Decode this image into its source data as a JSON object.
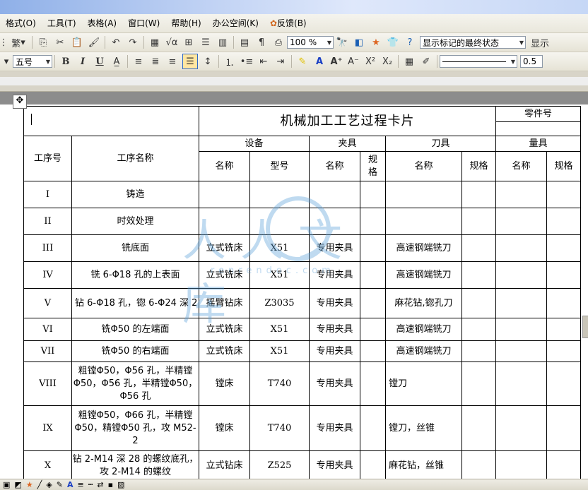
{
  "menubar": {
    "items": [
      "格式(O)",
      "工具(T)",
      "表格(A)",
      "窗口(W)",
      "帮助(H)",
      "办公空间(K)",
      "反馈(B)"
    ]
  },
  "toolbar1": {
    "traditional_label": "繁",
    "zoom_value": "100 %",
    "markup_display": "显示标记的最终状态",
    "show_label": "显示"
  },
  "toolbar2": {
    "font_size": "五号",
    "bold": "B",
    "italic": "I",
    "underline": "U",
    "line_width": "0.5"
  },
  "table": {
    "title": "机械加工工艺过程卡片",
    "part_no_label": "零件号",
    "col_step_no": "工序号",
    "col_step_name": "工序名称",
    "group_equipment": "设备",
    "group_fixture": "夹具",
    "group_tool": "刀具",
    "group_gauge": "量具",
    "sub_name": "名称",
    "sub_model": "型号",
    "sub_spec": "规格",
    "sub_spec_split": "规\n格",
    "rows": [
      {
        "no": "I",
        "name": "铸造",
        "eq_name": "",
        "eq_model": "",
        "fx_name": "",
        "tool_name": ""
      },
      {
        "no": "II",
        "name": "时效处理",
        "eq_name": "",
        "eq_model": "",
        "fx_name": "",
        "tool_name": ""
      },
      {
        "no": "III",
        "name": "铣底面",
        "eq_name": "立式铣床",
        "eq_model": "X51",
        "fx_name": "专用夹具",
        "tool_name": "高速钢端铣刀"
      },
      {
        "no": "IV",
        "name": "铣 6-Φ18 孔的上表面",
        "eq_name": "立式铣床",
        "eq_model": "X51",
        "fx_name": "专用夹具",
        "tool_name": "高速钢端铣刀"
      },
      {
        "no": "V",
        "name": "钻 6-Φ18 孔，锪 6-Φ24 深 2",
        "eq_name": "摇臂钻床",
        "eq_model": "Z3035",
        "fx_name": "专用夹具",
        "tool_name": "麻花钻,锪孔刀"
      },
      {
        "no": "VI",
        "name": "铣Φ50 的左端面",
        "eq_name": "立式铣床",
        "eq_model": "X51",
        "fx_name": "专用夹具",
        "tool_name": "高速钢端铣刀"
      },
      {
        "no": "VII",
        "name": "铣Φ50 的右端面",
        "eq_name": "立式铣床",
        "eq_model": "X51",
        "fx_name": "专用夹具",
        "tool_name": "高速钢端铣刀"
      },
      {
        "no": "VIII",
        "name": "粗镗Φ50，Φ56 孔，半精镗Φ50，Φ56 孔，半精镗Φ50，Φ56 孔",
        "eq_name": "镗床",
        "eq_model": "T740",
        "fx_name": "专用夹具",
        "tool_name": "镗刀"
      },
      {
        "no": "IX",
        "name": "粗镗Φ50，Φ66 孔，半精镗Φ50，精镗Φ50 孔，攻 M52-2",
        "eq_name": "镗床",
        "eq_model": "T740",
        "fx_name": "专用夹具",
        "tool_name": "镗刀，丝锥"
      },
      {
        "no": "X",
        "name": "钻 2-M14 深 28 的螺纹底孔，攻 2-M14 的螺纹",
        "eq_name": "立式钻床",
        "eq_model": "Z525",
        "fx_name": "专用夹具",
        "tool_name": "麻花钻，丝锥"
      }
    ]
  },
  "watermark": {
    "text": "人人文库",
    "url": "renrendoc.com"
  },
  "colors": {
    "menubar_bg": "#ece9d8",
    "watermark": "#5aa0d8",
    "doc_bg": "#8c8c8c"
  }
}
